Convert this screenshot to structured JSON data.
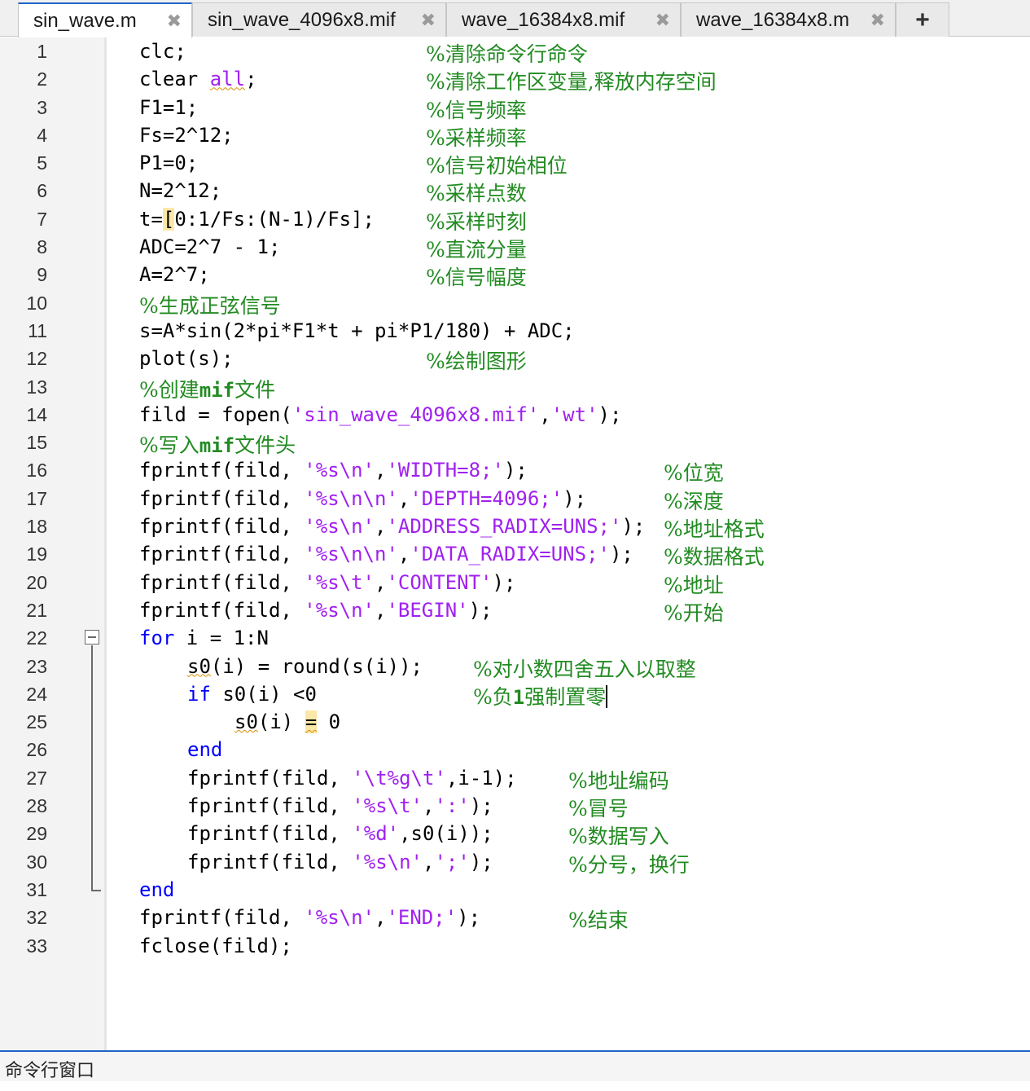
{
  "tabs": [
    {
      "label": "sin_wave.m",
      "active": true
    },
    {
      "label": "sin_wave_4096x8.mif",
      "active": false
    },
    {
      "label": "wave_16384x8.mif",
      "active": false
    },
    {
      "label": "wave_16384x8.m",
      "active": false
    }
  ],
  "close_glyph": "✖",
  "add_tab_glyph": "+",
  "colors": {
    "keyword": "#0000ff",
    "string": "#a020f0",
    "comment": "#228b22",
    "tab_accent": "#1e64c8"
  },
  "editor": {
    "line_numbers": [
      "1",
      "2",
      "3",
      "4",
      "5",
      "6",
      "7",
      "8",
      "9",
      "10",
      "11",
      "12",
      "13",
      "14",
      "15",
      "16",
      "17",
      "18",
      "19",
      "20",
      "21",
      "22",
      "23",
      "24",
      "25",
      "26",
      "27",
      "28",
      "29",
      "30",
      "31",
      "32",
      "33"
    ],
    "l1": {
      "code": "clc;",
      "comment": "%清除命令行命令"
    },
    "l2": {
      "code": "clear ",
      "arg": "all",
      "end": ";",
      "comment": "%清除工作区变量,释放内存空间"
    },
    "l3": {
      "code": "F1=1;",
      "comment": "%信号频率"
    },
    "l4": {
      "code": "Fs=2^12;",
      "comment": "%采样频率"
    },
    "l5": {
      "code": "P1=0;",
      "comment": "%信号初始相位"
    },
    "l6": {
      "code": "N=2^12;",
      "comment": "%采样点数"
    },
    "l7": {
      "pre": "t=",
      "bracket": "[",
      "code": "0:1/Fs:(N-1)/Fs];",
      "comment": "%采样时刻"
    },
    "l8": {
      "code": "ADC=2^7 - 1;",
      "comment": "%直流分量"
    },
    "l9": {
      "code": "A=2^7;",
      "comment": "%信号幅度"
    },
    "l10": {
      "comment": "%生成正弦信号"
    },
    "l11": {
      "code": "s=A*sin(2*pi*F1*t + pi*P1/180) + ADC;"
    },
    "l12": {
      "code": "plot(s);",
      "comment": "%绘制图形"
    },
    "l13": {
      "c1": "%创建",
      "c2": "mif",
      "c3": "文件"
    },
    "l14": {
      "pre": "fild = fopen(",
      "s1": "'sin_wave_4096x8.mif'",
      "mid": ",",
      "s2": "'wt'",
      "end": ");"
    },
    "l15": {
      "c1": "%写入",
      "c2": "mif",
      "c3": "文件头"
    },
    "l16": {
      "pre": "fprintf(fild, ",
      "s1": "'%s\\n'",
      "mid": ",",
      "s2": "'WIDTH=8;'",
      "end": ");",
      "comment": "%位宽"
    },
    "l17": {
      "pre": "fprintf(fild, ",
      "s1": "'%s\\n\\n'",
      "mid": ",",
      "s2": "'DEPTH=4096;'",
      "end": ");",
      "comment": "%深度"
    },
    "l18": {
      "pre": "fprintf(fild, ",
      "s1": "'%s\\n'",
      "mid": ",",
      "s2": "'ADDRESS_RADIX=UNS;'",
      "end": ");",
      "comment": "%地址格式"
    },
    "l19": {
      "pre": "fprintf(fild, ",
      "s1": "'%s\\n\\n'",
      "mid": ",",
      "s2": "'DATA_RADIX=UNS;'",
      "end": ");",
      "comment": "%数据格式"
    },
    "l20": {
      "pre": "fprintf(fild, ",
      "s1": "'%s\\t'",
      "mid": ",",
      "s2": "'CONTENT'",
      "end": ");",
      "comment": "%地址"
    },
    "l21": {
      "pre": "fprintf(fild, ",
      "s1": "'%s\\n'",
      "mid": ",",
      "s2": "'BEGIN'",
      "end": ");",
      "comment": "%开始"
    },
    "l22": {
      "kw": "for",
      "code": " i = 1:N"
    },
    "l23": {
      "var": "s0",
      "code": "(i) = round(s(i));",
      "comment": "%对小数四舍五入以取整"
    },
    "l24": {
      "kw": "if",
      "code": " s0(i) <0",
      "c1": "%负",
      "c2": "1",
      "c3": "强制置零"
    },
    "l25": {
      "var": "s0",
      "code": "(i) ",
      "eq": "=",
      "end": " 0"
    },
    "l26": {
      "kw": "end"
    },
    "l27": {
      "pre": "fprintf(fild, ",
      "s1": "'\\t%g\\t'",
      "end": ",i-1);",
      "comment": "%地址编码"
    },
    "l28": {
      "pre": "fprintf(fild, ",
      "s1": "'%s\\t'",
      "mid": ",",
      "s2": "':'",
      "end": ");",
      "comment": "%冒号"
    },
    "l29": {
      "pre": "fprintf(fild, ",
      "s1": "'%d'",
      "end": ",s0(i));",
      "comment": "%数据写入"
    },
    "l30": {
      "pre": "fprintf(fild, ",
      "s1": "'%s\\n'",
      "mid": ",",
      "s2": "';'",
      "end": ");",
      "comment": "%分号，换行"
    },
    "l31": {
      "kw": "end"
    },
    "l32": {
      "pre": "fprintf(fild, ",
      "s1": "'%s\\n'",
      "mid": ",",
      "s2": "'END;'",
      "end": ");",
      "comment": "%结束"
    },
    "l33": {
      "code": "fclose(fild);"
    }
  },
  "command_window": {
    "title": "命令行窗口"
  }
}
